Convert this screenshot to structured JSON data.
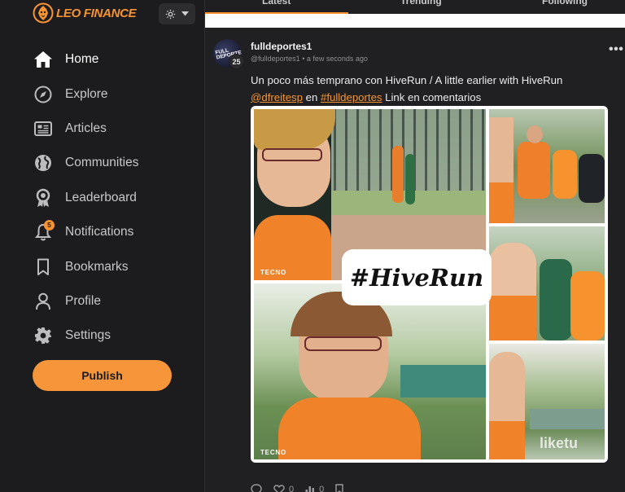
{
  "brand": {
    "name": "LEO FINANCE",
    "accent": "#f79431"
  },
  "nav": {
    "home": "Home",
    "explore": "Explore",
    "articles": "Articles",
    "communities": "Communities",
    "leaderboard": "Leaderboard",
    "notifications": "Notifications",
    "notifications_badge": "5",
    "bookmarks": "Bookmarks",
    "profile": "Profile",
    "settings": "Settings"
  },
  "publish_label": "Publish",
  "tabs": {
    "latest": "Latest",
    "trending": "Trending",
    "following": "Following"
  },
  "post": {
    "avatar_text": "FULL DEPORTES",
    "reputation": "25",
    "author": "fulldeportes1",
    "handle": "@fulldeportes1",
    "separator": "•",
    "time": "a few seconds ago",
    "more": "•••",
    "text_line1": "Un poco más temprano con HiveRun / A little earlier with HiveRun",
    "mention": "@dfreitesp",
    "en": "en",
    "hashtag_link": "#fulldeportes",
    "text_tail": "Link en comentarios",
    "collage_title": "#HiveRun",
    "watermark_tecno": "TECNO",
    "watermark_liketu": "liketu",
    "actions": {
      "likes": "0",
      "tips": "0"
    }
  }
}
